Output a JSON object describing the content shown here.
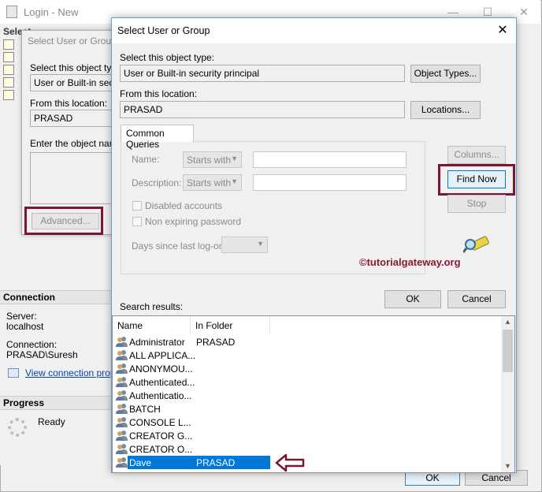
{
  "login_window": {
    "title": "Login - New",
    "select_header": "Select",
    "connection_header": "Connection",
    "server_label": "Server:",
    "server_value": "localhost",
    "connection_label": "Connection:",
    "connection_value": "PRASAD\\Suresh",
    "view_link": "View connection prope",
    "progress_header": "Progress",
    "progress_status": "Ready",
    "ok_label": "OK",
    "cancel_label": "Cancel"
  },
  "middle_dialog": {
    "title": "Select User or Group",
    "object_type_label": "Select this object type",
    "object_type_value": "User or Built-in securi",
    "location_label": "From this location:",
    "location_value": "PRASAD",
    "enter_label": "Enter the object name",
    "advanced_label": "Advanced..."
  },
  "dialog": {
    "title": "Select User or Group",
    "close_glyph": "✕",
    "object_type_label": "Select this object type:",
    "object_type_value": "User or Built-in security principal",
    "object_types_button": "Object Types...",
    "location_label": "From this location:",
    "location_value": "PRASAD",
    "locations_button": "Locations...",
    "tab_common_queries": "Common Queries",
    "name_label": "Name:",
    "description_label": "Description:",
    "starts_with": "Starts with",
    "disabled_accounts": "Disabled accounts",
    "non_expiring_password": "Non expiring password",
    "days_since_logon": "Days since last log-on:",
    "columns_button": "Columns...",
    "find_now_button": "Find Now",
    "stop_button": "Stop",
    "watermark": "©tutorialgateway.org",
    "ok_button": "OK",
    "cancel_button": "Cancel",
    "search_results_label": "Search results:",
    "col_name": "Name",
    "col_folder": "In Folder",
    "results": [
      {
        "name": "Administrator",
        "folder": "PRASAD"
      },
      {
        "name": "ALL APPLICA...",
        "folder": ""
      },
      {
        "name": "ANONYMOU...",
        "folder": ""
      },
      {
        "name": "Authenticated...",
        "folder": ""
      },
      {
        "name": "Authenticatio...",
        "folder": ""
      },
      {
        "name": "BATCH",
        "folder": ""
      },
      {
        "name": "CONSOLE L...",
        "folder": ""
      },
      {
        "name": "CREATOR G...",
        "folder": ""
      },
      {
        "name": "CREATOR O...",
        "folder": ""
      },
      {
        "name": "Dave",
        "folder": "PRASAD",
        "selected": true
      }
    ]
  },
  "colors": {
    "selection": "#0078d7",
    "highlight_frame": "#7b1630",
    "watermark": "#8a1a32",
    "link": "#0645ad"
  }
}
